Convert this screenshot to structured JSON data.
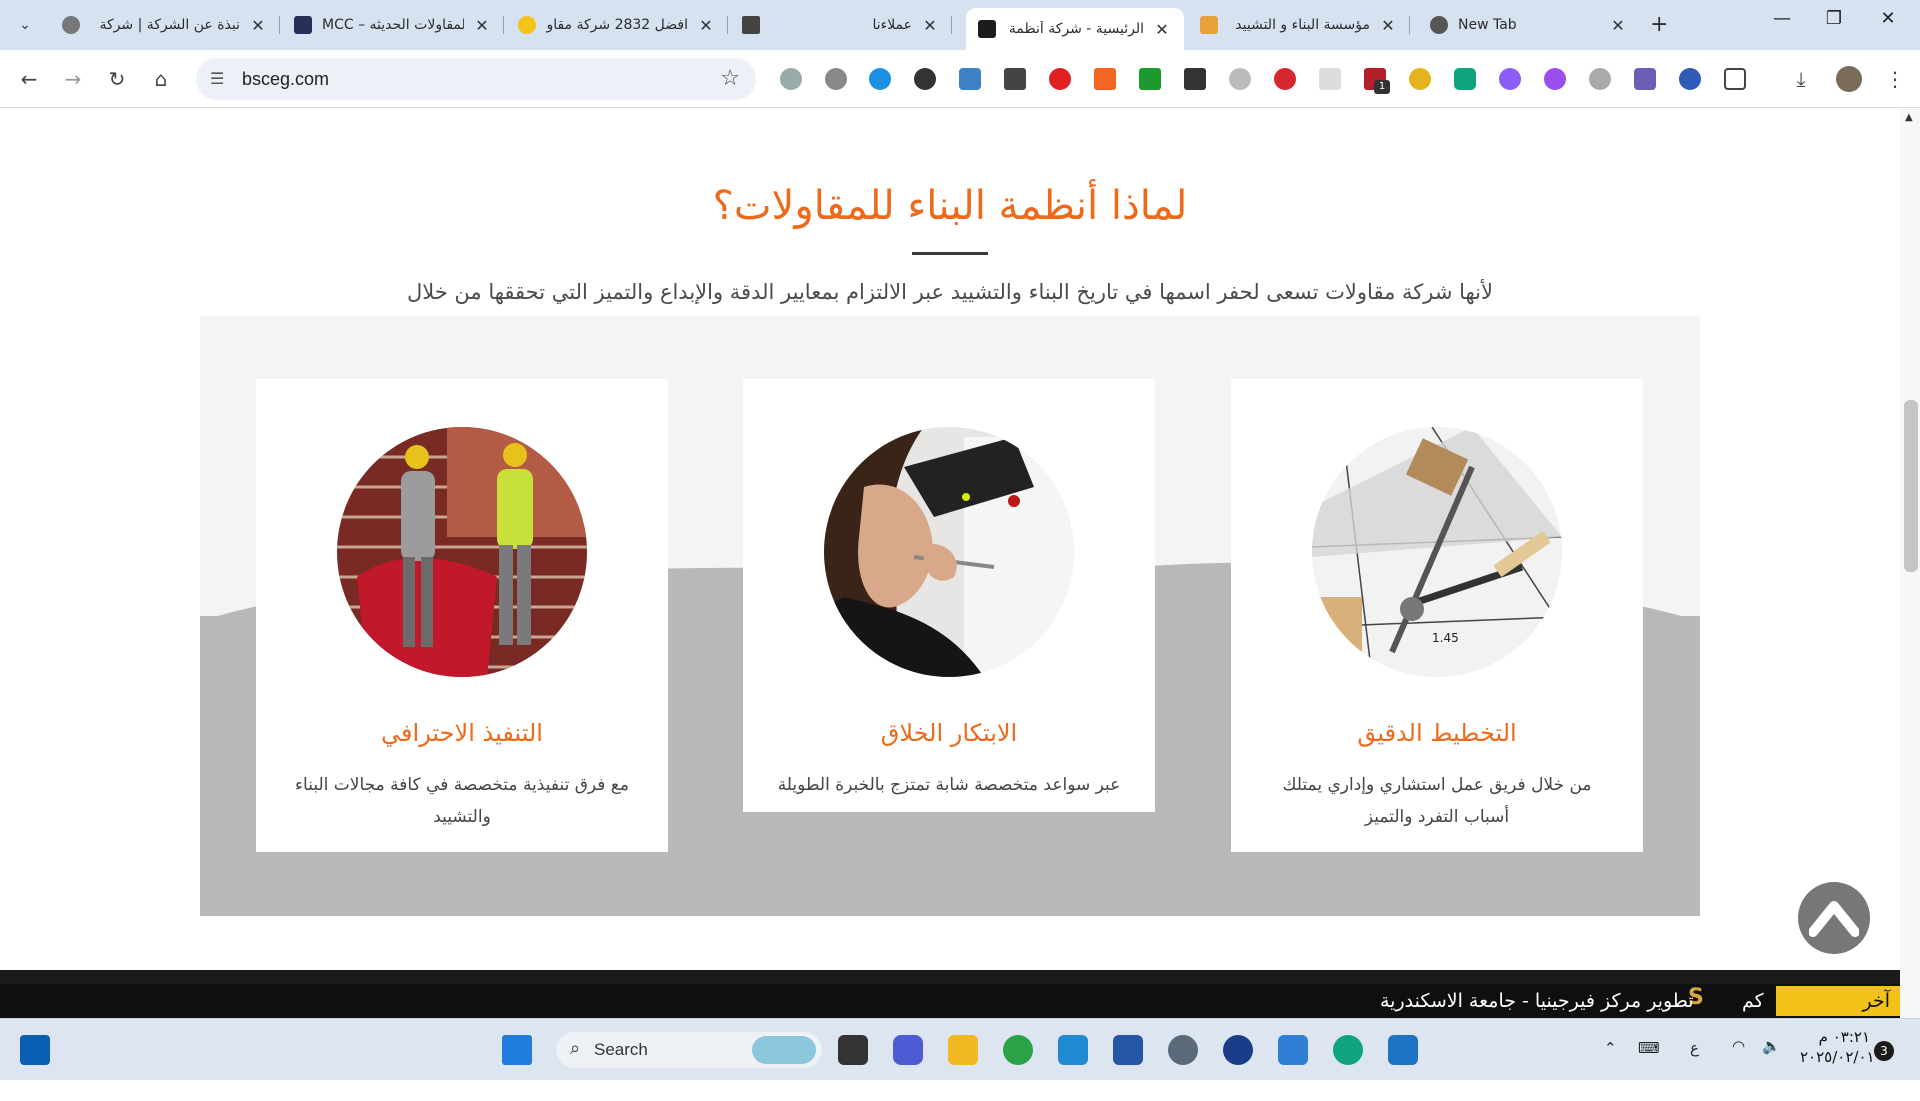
{
  "browser": {
    "tabs": [
      {
        "title": "نبذة عن الشركة | شركة",
        "active": false
      },
      {
        "title": "MCC – المقاولات الحديثه",
        "active": false
      },
      {
        "title": "افضل 2832 شركة مقاو",
        "active": false
      },
      {
        "title": "عملاءنا",
        "active": false
      },
      {
        "title": "الرئيسية - شركة أنظمة",
        "active": true
      },
      {
        "title": "مؤسسة البناء و التشييد",
        "active": false
      },
      {
        "title": "New Tab",
        "active": false
      }
    ],
    "url": "bsceg.com",
    "extension_badge": "1"
  },
  "section": {
    "title": "لماذا أنظمة البناء للمقاولات؟",
    "subtitle": "لأنها شركة مقاولات تسعى لحفر اسمها في تاريخ البناء والتشييد عبر الالتزام بمعايير الدقة والإبداع والتميز التي تحققها من خلال"
  },
  "cards": [
    {
      "title": "التخطيط الدقيق",
      "desc": "من خلال فريق عمل استشاري وإداري يمتلك أسباب التفرد والتميز"
    },
    {
      "title": "الابتكار الخلاق",
      "desc": "عبر سواعد متخصصة شابة تمتزج بالخبرة الطويلة"
    },
    {
      "title": "التنفيذ الاحترافي",
      "desc": "مع فرق تنفيذية متخصصة في كافة مجالات البناء والتشييد"
    }
  ],
  "news": {
    "label": "آخر المستجدات",
    "km": "كم",
    "text": "تطوير مركز فيرجينيا - جامعة الاسكندرية"
  },
  "taskbar": {
    "search_label": "Search",
    "time": "٠٣:٢١ م",
    "date": "٢٠٢٥/٠٢/٠١",
    "lang": "ع",
    "notifications": "3"
  },
  "colors": {
    "accent": "#ee6a1a",
    "gray_block": "#b8b8b8",
    "news_label": "#f2c21b"
  }
}
